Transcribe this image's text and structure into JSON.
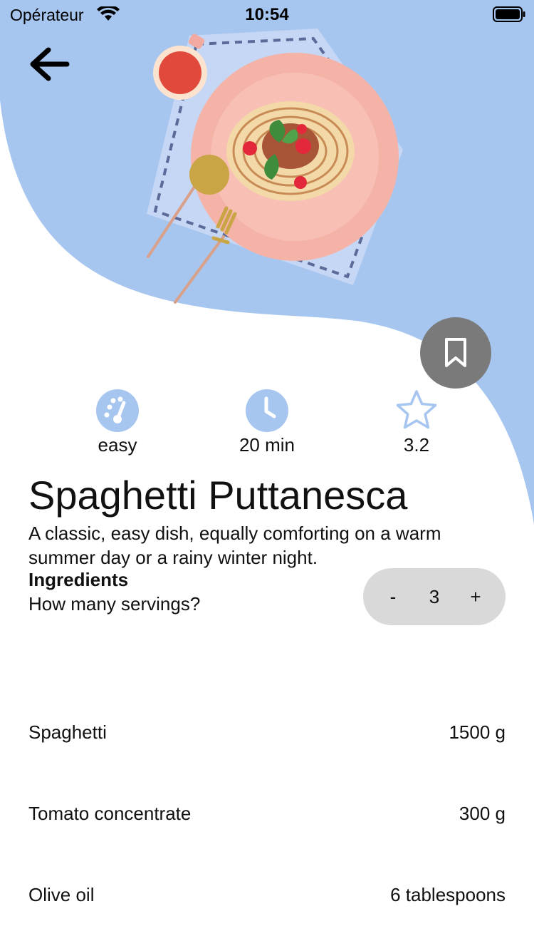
{
  "status_bar": {
    "carrier": "Opérateur",
    "time": "10:54"
  },
  "colors": {
    "wave": "#a6c6f0",
    "accent_icon": "#a6c6f0",
    "bookmark_button": "#7a7a7a",
    "stepper_bg": "#d9d9d9"
  },
  "icons": {
    "back": "arrow-left-icon",
    "bookmark": "bookmark-icon",
    "difficulty": "gauge-icon",
    "time": "clock-icon",
    "rating": "star-icon"
  },
  "stats": {
    "difficulty": "easy",
    "time": "20 min",
    "rating": "3.2"
  },
  "recipe": {
    "title": "Spaghetti Puttanesca",
    "description": "A classic, easy dish, equally comforting on a warm summer day or a rainy winter night."
  },
  "ingredients": {
    "heading": "Ingredients",
    "servings_question": "How many servings?",
    "stepper": {
      "minus": "-",
      "value": "3",
      "plus": "+"
    },
    "items": [
      {
        "name": "Spaghetti",
        "amount": "1500 g"
      },
      {
        "name": "Tomato concentrate",
        "amount": "300 g"
      },
      {
        "name": "Olive oil",
        "amount": "6 tablespoons"
      }
    ]
  }
}
